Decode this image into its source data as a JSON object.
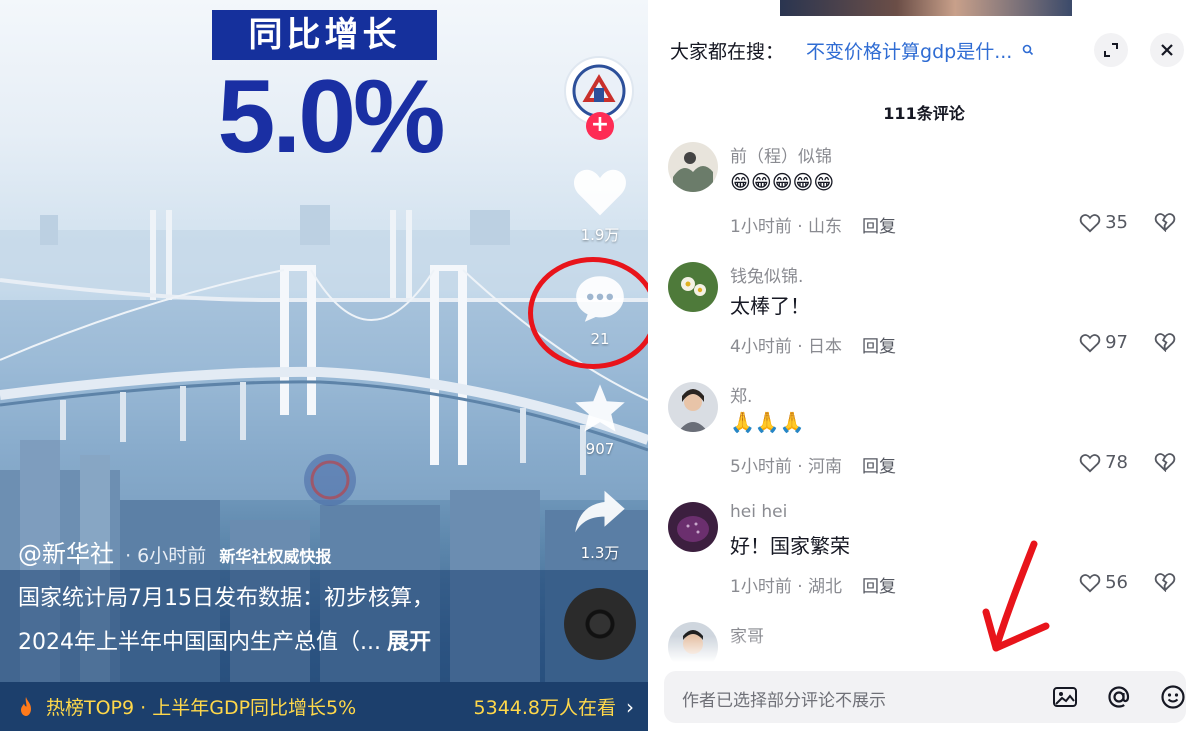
{
  "video": {
    "headline": "同比增长",
    "big_number": "5.0%",
    "side": {
      "likes": "1.9万",
      "comments": "21",
      "favorites": "907",
      "shares": "1.3万"
    },
    "author": "@新华社",
    "time": "· 6小时前",
    "tag": "新华社权威快报",
    "desc_line1": "国家统计局7月15日发布数据：初步核算，",
    "desc_line2": "2024年上半年中国国内生产总值（...",
    "expand_label": "展开",
    "hot_topic": "热榜TOP9 · 上半年GDP同比增长5%",
    "hot_viewers": "5344.8万人在看",
    "hot_chevron": "›"
  },
  "comments_panel": {
    "search_label": "大家都在搜：",
    "search_query": "不变价格计算gdp是什...",
    "count_title": "111条评论",
    "input_placeholder": "作者已选择部分评论不展示",
    "items": [
      {
        "name": "前（程）似锦",
        "text": "😁😁😁😁😁",
        "time_loc": "1小时前 · 山东",
        "reply": "回复",
        "likes": "35"
      },
      {
        "name": "钱兔似锦.",
        "text": "太棒了！",
        "time_loc": "4小时前 · 日本",
        "reply": "回复",
        "likes": "97"
      },
      {
        "name": "郑.",
        "text": "🙏🙏🙏",
        "time_loc": "5小时前 · 河南",
        "reply": "回复",
        "likes": "78"
      },
      {
        "name": "hei hei",
        "text": "好！国家繁荣",
        "time_loc": "1小时前 · 湖北",
        "reply": "回复",
        "likes": "56"
      },
      {
        "name": "家哥",
        "text": "",
        "time_loc": "",
        "reply": "",
        "likes": ""
      }
    ]
  },
  "colors": {
    "accent_red": "#fe2c55",
    "annotation_red": "#e8141b",
    "headline_blue": "#15309c",
    "link_blue": "#2f6cd3",
    "hot_yellow": "#ffd84a"
  },
  "icons": [
    "heart-icon",
    "comment-icon",
    "star-icon",
    "share-icon",
    "music-disc-icon",
    "flame-icon",
    "search-icon",
    "expand-icon",
    "close-icon",
    "like-icon",
    "dislike-icon",
    "image-icon",
    "at-icon",
    "emoji-icon"
  ]
}
